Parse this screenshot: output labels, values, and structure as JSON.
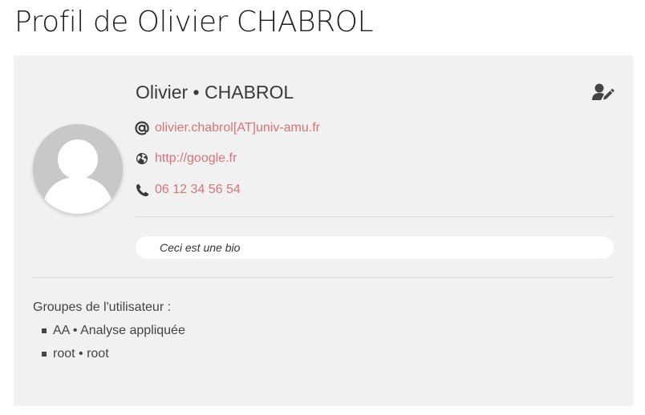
{
  "page": {
    "title": "Profil de Olivier CHABROL"
  },
  "profile": {
    "name": "Olivier • CHABROL",
    "email": "olivier.chabrol[AT]univ-amu.fr",
    "website": "http://google.fr",
    "phone": "06 12 34 56 54",
    "bio": "Ceci est une bio",
    "avatar_icon": "user-silhouette-icon",
    "edit_icon": "user-edit-icon"
  },
  "groups": {
    "label": "Groupes de l'utilisateur :",
    "items": [
      "AA • Analyse appliquée",
      "root • root"
    ]
  },
  "colors": {
    "link": "#d9727a",
    "card_background": "#f1f1f1",
    "avatar": "#c8c8c8",
    "text": "#444444"
  }
}
